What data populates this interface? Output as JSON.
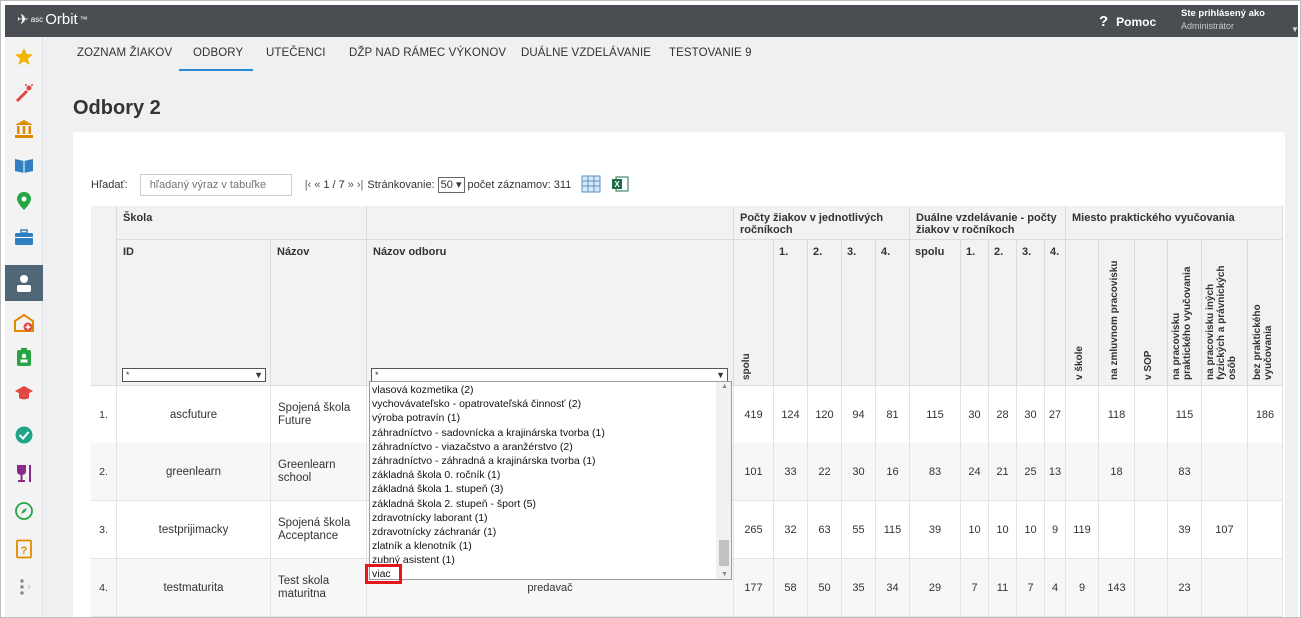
{
  "app": {
    "logo_prefix": "asc",
    "logo_name": "Orbit",
    "logo_tm": "™"
  },
  "header": {
    "help_label": "Pomoc",
    "user_line1": "Ste prihlásený ako",
    "user_line2": "Administrátor"
  },
  "sidebar": {
    "items": [
      {
        "icon": "star-icon",
        "color": "#f2b600"
      },
      {
        "icon": "magic-wand-icon",
        "color": "#e0483f"
      },
      {
        "icon": "institution-icon",
        "color": "#e08a00"
      },
      {
        "icon": "book-icon",
        "color": "#2f7fc1"
      },
      {
        "icon": "map-pin-icon",
        "color": "#27a544"
      },
      {
        "icon": "briefcase-icon",
        "color": "#2f7fc1"
      },
      {
        "icon": "student-icon",
        "color": "#ffffff",
        "active": true
      },
      {
        "icon": "school-add-icon",
        "color": "#e08a00"
      },
      {
        "icon": "badge-icon",
        "color": "#27a544"
      },
      {
        "icon": "graduation-cap-icon",
        "color": "#e0483f"
      },
      {
        "icon": "check-badge-icon",
        "color": "#1fa589"
      },
      {
        "icon": "trophy-icon",
        "color": "#8a2a8a"
      },
      {
        "icon": "compass-icon",
        "color": "#27a544"
      },
      {
        "icon": "help-doc-icon",
        "color": "#e08a00"
      },
      {
        "icon": "more-icon",
        "color": "#888888"
      }
    ]
  },
  "tabs": [
    {
      "label": "ZOZNAM ŽIAKOV"
    },
    {
      "label": "ODBORY",
      "active": true
    },
    {
      "label": "UTEČENCI"
    },
    {
      "label": "DŽP NAD RÁMEC VÝKONOV"
    },
    {
      "label": "DUÁLNE VZDELÁVANIE"
    },
    {
      "label": "TESTOVANIE 9"
    }
  ],
  "page_title": "Odbory 2",
  "toolbar": {
    "search_label": "Hľadať:",
    "search_placeholder": "hľadaný výraz v tabuľke",
    "pager_first": "|‹",
    "pager_prev": "«",
    "pager_text": "1 / 7",
    "pager_next": "»",
    "pager_last": "›|",
    "paging_label": "Stránkovanie:",
    "paging_value": "50",
    "count_label": "počet záznamov: 311"
  },
  "table": {
    "group_school": "Škola",
    "col_id": "ID",
    "col_name": "Názov",
    "col_branch": "Názov odboru",
    "group_counts": "Počty žiakov v jednotlivých ročníkoch",
    "group_dual": "Duálne vzdelávanie - počty žiakov v ročníkoch",
    "group_place": "Miesto praktického vyučovania",
    "spolu": "spolu",
    "g1": "1.",
    "g2": "2.",
    "g3": "3.",
    "g4": "4.",
    "place_cols": [
      "v škole",
      "na zmluvnom pracovisku",
      "v SOP",
      "na pracovisku praktického vyučovania",
      "na pracovisku iných fyzických a právnických osôb",
      "bez praktického vyučovania"
    ],
    "filter_value": "*",
    "rows": [
      {
        "num": "1.",
        "id": "ascfuture",
        "name": "Spojená škola Future",
        "branch": "",
        "spolu": "419",
        "c1": "124",
        "c2": "120",
        "c3": "94",
        "c4": "81",
        "dspolu": "115",
        "d1": "30",
        "d2": "28",
        "d3": "30",
        "d4": "27",
        "p1": "",
        "p2": "118",
        "p3": "",
        "p4": "115",
        "p5": "",
        "p6": "186"
      },
      {
        "num": "2.",
        "id": "greenlearn",
        "name": "Greenlearn school",
        "branch": "",
        "spolu": "101",
        "c1": "33",
        "c2": "22",
        "c3": "30",
        "c4": "16",
        "dspolu": "83",
        "d1": "24",
        "d2": "21",
        "d3": "25",
        "d4": "13",
        "p1": "",
        "p2": "18",
        "p3": "",
        "p4": "83",
        "p5": "",
        "p6": ""
      },
      {
        "num": "3.",
        "id": "testprijimacky",
        "name": "Spojená škola Acceptance",
        "branch": "",
        "spolu": "265",
        "c1": "32",
        "c2": "63",
        "c3": "55",
        "c4": "115",
        "dspolu": "39",
        "d1": "10",
        "d2": "10",
        "d3": "10",
        "d4": "9",
        "p1": "119",
        "p2": "",
        "p3": "",
        "p4": "39",
        "p5": "107",
        "p6": ""
      },
      {
        "num": "4.",
        "id": "testmaturita",
        "name": "Test skola maturitna",
        "branch": "predavač",
        "spolu": "177",
        "c1": "58",
        "c2": "50",
        "c3": "35",
        "c4": "34",
        "dspolu": "29",
        "d1": "7",
        "d2": "11",
        "d3": "7",
        "d4": "4",
        "p1": "9",
        "p2": "143",
        "p3": "",
        "p4": "23",
        "p5": "",
        "p6": ""
      }
    ]
  },
  "dropdown": {
    "items": [
      "vlasová kozmetika (2)",
      "vychovávateľsko - opatrovateľská činnosť (2)",
      "výroba potravín (1)",
      "záhradníctvo - sadovnícka a krajinárska tvorba (1)",
      "záhradníctvo - viazačstvo a aranžérstvo (2)",
      "záhradníctvo - záhradná a krajinárska tvorba (1)",
      "základná škola 0. ročník (1)",
      "základná škola 1. stupeň (3)",
      "základná škola 2. stupeň - šport (5)",
      "zdravotnícky laborant (1)",
      "zdravotnícky záchranár (1)",
      "zlatník a klenotník (1)",
      "zubný asistent (1)"
    ],
    "more_label": "viac"
  }
}
